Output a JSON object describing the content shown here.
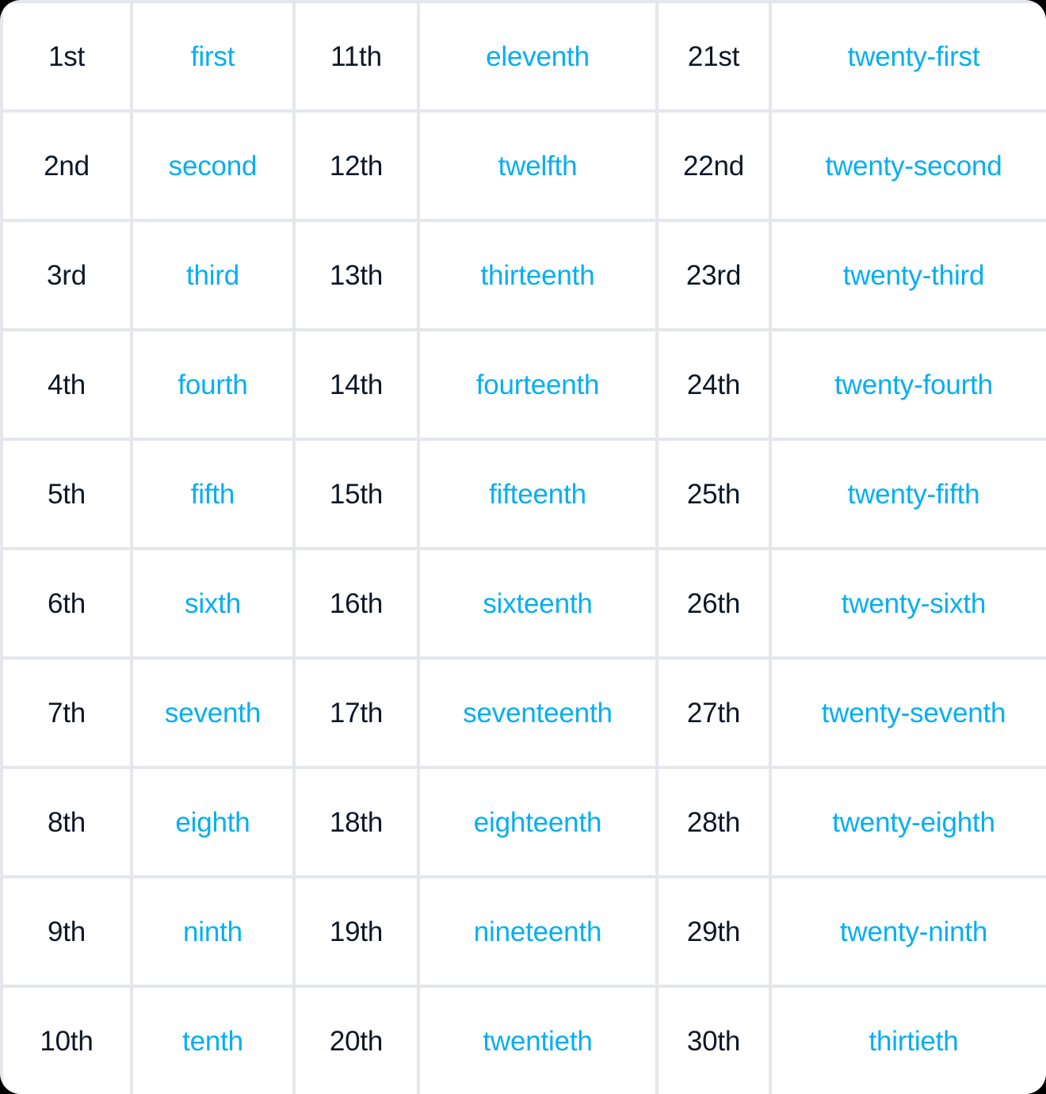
{
  "card": {
    "background_color": "#e4e7eb",
    "cell_background_color": "#ffffff",
    "abbreviation_color": "#0d1726",
    "word_color": "#06aef2"
  },
  "table": {
    "columns": 6,
    "rows_count": 10,
    "rows": [
      {
        "abbr1": "1st",
        "word1": "first",
        "abbr2": "11th",
        "word2": "eleventh",
        "abbr3": "21st",
        "word3": "twenty-first"
      },
      {
        "abbr1": "2nd",
        "word1": "second",
        "abbr2": "12th",
        "word2": "twelfth",
        "abbr3": "22nd",
        "word3": "twenty-second"
      },
      {
        "abbr1": "3rd",
        "word1": "third",
        "abbr2": "13th",
        "word2": "thirteenth",
        "abbr3": "23rd",
        "word3": "twenty-third"
      },
      {
        "abbr1": "4th",
        "word1": "fourth",
        "abbr2": "14th",
        "word2": "fourteenth",
        "abbr3": "24th",
        "word3": "twenty-fourth"
      },
      {
        "abbr1": "5th",
        "word1": "fifth",
        "abbr2": "15th",
        "word2": "fifteenth",
        "abbr3": "25th",
        "word3": "twenty-fifth"
      },
      {
        "abbr1": "6th",
        "word1": "sixth",
        "abbr2": "16th",
        "word2": "sixteenth",
        "abbr3": "26th",
        "word3": "twenty-sixth"
      },
      {
        "abbr1": "7th",
        "word1": "seventh",
        "abbr2": "17th",
        "word2": "seventeenth",
        "abbr3": "27th",
        "word3": "twenty-seventh"
      },
      {
        "abbr1": "8th",
        "word1": "eighth",
        "abbr2": "18th",
        "word2": "eighteenth",
        "abbr3": "28th",
        "word3": "twenty-eighth"
      },
      {
        "abbr1": "9th",
        "word1": "ninth",
        "abbr2": "19th",
        "word2": "nineteenth",
        "abbr3": "29th",
        "word3": "twenty-ninth"
      },
      {
        "abbr1": "10th",
        "word1": "tenth",
        "abbr2": "20th",
        "word2": "twentieth",
        "abbr3": "30th",
        "word3": "thirtieth"
      }
    ]
  }
}
